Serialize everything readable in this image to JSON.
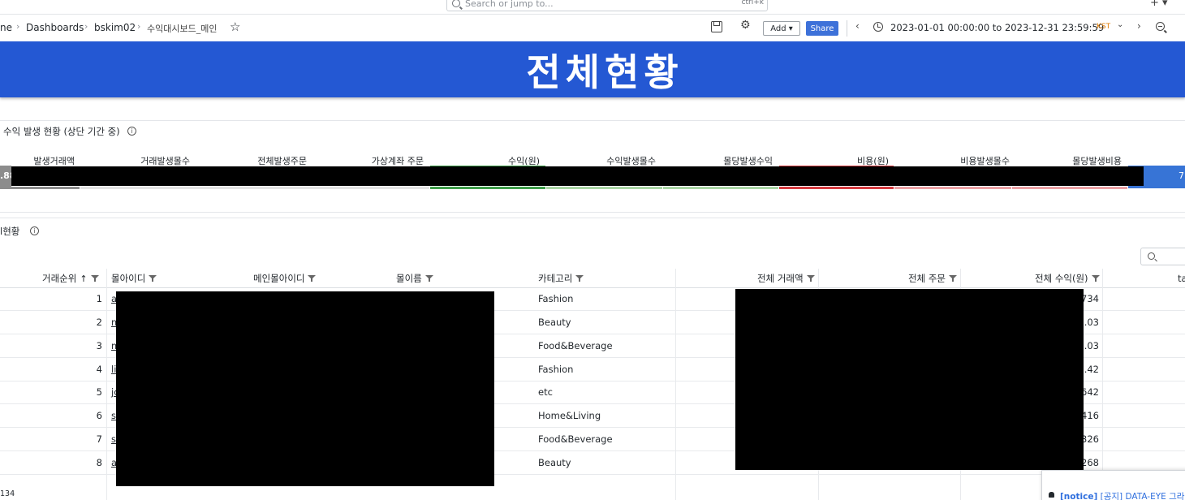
{
  "search": {
    "placeholder": "Search or jump to...",
    "shortcut": "ctrl+k"
  },
  "topbar": {
    "plus_label": "+ ▾"
  },
  "breadcrumb": {
    "home": "ne",
    "dashboards": "Dashboards",
    "folder": "bskim02",
    "current": "수익대시보드_메인"
  },
  "toolbar": {
    "add_label": "Add ▾",
    "share_label": "Share",
    "time_range": "2023-01-01 00:00:00 to 2023-12-31 23:59:59",
    "timezone": "KST"
  },
  "banner": {
    "title": "전체현황",
    "color": "#2458d3"
  },
  "panel_stats": {
    "title": "수익 발생 현황 (상단 기간 중)",
    "headers": [
      "발생거래액",
      "거래발생몰수",
      "전체발생주문",
      "가상계좌 주문",
      "수익(원)",
      "수익발생몰수",
      "몰당발생수익",
      "비용(원)",
      "비용발생몰수",
      "몰당발생비용"
    ],
    "first_value_fragment": ".88",
    "last_value_fragment": "7",
    "colors": {
      "neutral": "#8c8c8c",
      "neutral_light": "#e3e3e3",
      "profit": "#3f9e4a",
      "profit_light": "#a8d5a4",
      "cost": "#d63a3f",
      "cost_light": "#eba0a4",
      "blue": "#3774d6"
    }
  },
  "panel_table": {
    "title": "l현황",
    "columns": [
      "거래순위",
      "몰아이디",
      "메인몰아이디",
      "몰이름",
      "카테고리",
      "전체 거래액",
      "전체 주문",
      "전체 수익(원)",
      "ta"
    ],
    "rows": [
      {
        "rank": "1",
        "id_stub": "a",
        "category": "Fashion",
        "profit_tail": "734"
      },
      {
        "rank": "2",
        "id_stub": "m",
        "category": "Beauty",
        "profit_tail": ".03"
      },
      {
        "rank": "3",
        "id_stub": "m",
        "category": "Food&Beverage",
        "profit_tail": ".03"
      },
      {
        "rank": "4",
        "id_stub": "li",
        "category": "Fashion",
        "profit_tail": "7.42"
      },
      {
        "rank": "5",
        "id_stub": "jc",
        "category": "etc",
        "profit_tail": "642"
      },
      {
        "rank": "6",
        "id_stub": "s",
        "category": "Home&Living",
        "profit_tail": "416"
      },
      {
        "rank": "7",
        "id_stub": "s",
        "category": "Food&Beverage",
        "profit_tail": "326"
      },
      {
        "rank": "8",
        "id_stub": "a",
        "category": "Beauty",
        "profit_tail": "268"
      }
    ]
  },
  "status": {
    "left_text": "134"
  },
  "notice": {
    "tag": "[notice]",
    "text": "[공지] DATA-EYE 그라"
  }
}
